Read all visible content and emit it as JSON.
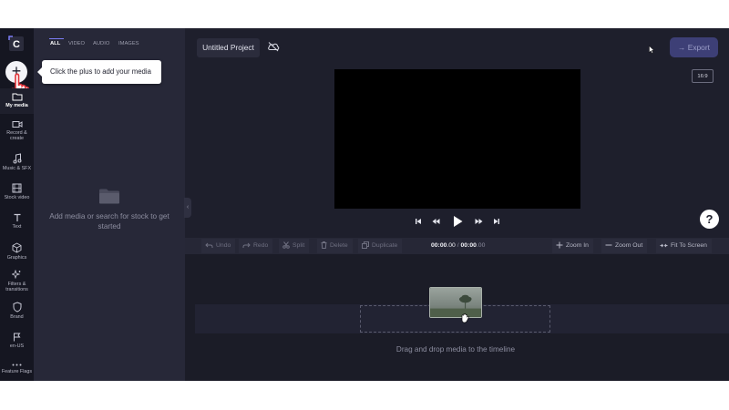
{
  "media_panel": {
    "tabs": [
      {
        "label": "ALL",
        "active": true
      },
      {
        "label": "VIDEO",
        "active": false
      },
      {
        "label": "AUDIO",
        "active": false
      },
      {
        "label": "IMAGES",
        "active": false
      }
    ],
    "empty_message": "Add media or search for stock to get started"
  },
  "sidebar": {
    "items": [
      {
        "label": "My media",
        "icon": "folder-icon",
        "active": true
      },
      {
        "label": "Record & create",
        "icon": "camera-icon"
      },
      {
        "label": "Music & SFX",
        "icon": "music-note-icon"
      },
      {
        "label": "Stock video",
        "icon": "film-icon"
      },
      {
        "label": "Text",
        "icon": "text-icon"
      },
      {
        "label": "Graphics",
        "icon": "cube-icon"
      },
      {
        "label": "Filters & transitions",
        "icon": "sparkle-icon"
      },
      {
        "label": "Brand",
        "icon": "shield-icon"
      },
      {
        "label": "en-US",
        "icon": "flag-icon"
      },
      {
        "label": "Feature Flags",
        "icon": "more-icon"
      }
    ]
  },
  "tooltip": {
    "text": "Click the plus to add your media"
  },
  "header": {
    "project_name": "Untitled Project",
    "export_label": "Export"
  },
  "preview": {
    "aspect_ratio": "16:9"
  },
  "toolbar": {
    "undo": "Undo",
    "redo": "Redo",
    "split": "Split",
    "delete": "Delete",
    "duplicate": "Duplicate",
    "current_time": "00:00",
    "current_frames": ".00",
    "separator": " / ",
    "total_time": "00:00",
    "total_frames": ".00",
    "zoom_in": "Zoom In",
    "zoom_out": "Zoom Out",
    "fit": "Fit To Screen"
  },
  "timeline": {
    "drop_hint": "Drag and drop media to the timeline"
  },
  "colors": {
    "accent": "#7c7df5",
    "background": "#1e1f2c",
    "rail": "#151621",
    "panel": "#272838",
    "export_button": "#3d3f76"
  }
}
